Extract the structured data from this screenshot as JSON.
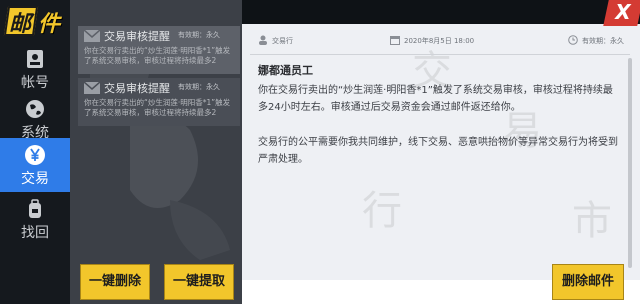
{
  "logo": {
    "char1": "邮",
    "char2": "件"
  },
  "nav": {
    "items": [
      {
        "label": "帐号",
        "icon": "id-card-icon",
        "active": false
      },
      {
        "label": "系统",
        "icon": "globe-icon",
        "active": false
      },
      {
        "label": "交易",
        "icon": "yen-icon",
        "active": true
      },
      {
        "label": "找回",
        "icon": "backpack-icon",
        "active": false
      }
    ]
  },
  "mails": [
    {
      "title": "交易审核提醒",
      "valid": "有效期：永久",
      "preview": "你在交易行卖出的“炒生润莲·明阳香*1”触发了系统交易审核，审核过程将持续最多2"
    },
    {
      "title": "交易审核提醒",
      "valid": "有效期：永久",
      "preview": "你在交易行卖出的“炒生润莲·明阳香*1”触发了系统交易审核，审核过程将持续最多2"
    }
  ],
  "list_buttons": {
    "delete_all": "一键删除",
    "claim_all": "一键提取"
  },
  "detail": {
    "sender": "交易行",
    "time": "2020年8月5日 18:00",
    "validity": "有效期：永久",
    "greeting": "娜都通员工",
    "paragraphs": [
      "你在交易行卖出的“炒生润莲·明阳香*1”触发了系统交易审核，审核过程将持续最多24小时左右。审核通过后交易资金会通过邮件返还给你。",
      "交易行的公平需要你我共同维护，线下交易、恶意哄抬物价等异常交易行为将受到严肃处理。"
    ],
    "delete_button": "删除邮件"
  },
  "close_label": "X",
  "colors": {
    "accent_yellow": "#f2c62b",
    "active_blue": "#2f7ce8",
    "close_red": "#d43b33"
  }
}
